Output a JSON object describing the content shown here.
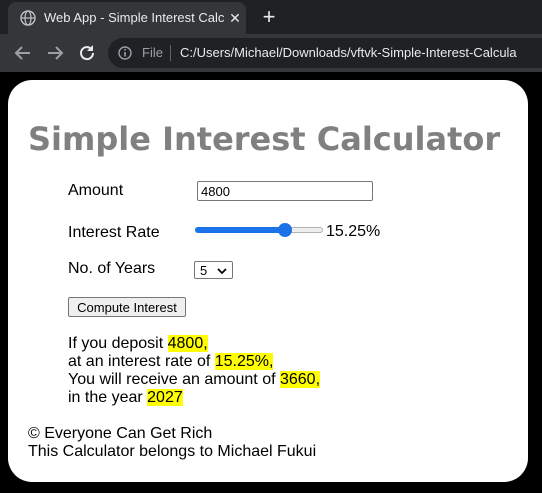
{
  "browser": {
    "tab_title": "Web App - Simple Interest Calcul",
    "tab_close_glyph": "✕",
    "new_tab_glyph": "+",
    "file_label": "File",
    "url": "C:/Users/Michael/Downloads/vftvk-Simple-Interest-Calcula"
  },
  "app": {
    "heading": "Simple Interest Calculator",
    "amount_label": "Amount",
    "amount_value": "4800",
    "rate_label": "Interest Rate",
    "rate_value": "15.25%",
    "rate_slider_fraction": 0.73,
    "years_label": "No. of Years",
    "years_value": "5",
    "compute_label": "Compute Interest",
    "result": {
      "line1_prefix": "If you deposit ",
      "line1_value": "4800,",
      "line2_prefix": "at an interest rate of ",
      "line2_value": "15.25%,",
      "line3_prefix": "You will receive an amount of ",
      "line3_value": "3660,",
      "line4_prefix": "in the year ",
      "line4_value": "2027"
    },
    "footer_line1": "© Everyone Can Get Rich",
    "footer_line2": "This Calculator belongs to Michael Fukui"
  },
  "colors": {
    "heading": "#808080",
    "highlight": "#ffff00",
    "slider_accent": "#1a73e8"
  },
  "icons": [
    "globe-icon",
    "close-icon",
    "plus-icon",
    "back-arrow-icon",
    "forward-arrow-icon",
    "reload-icon",
    "info-icon",
    "chevron-down-icon"
  ]
}
